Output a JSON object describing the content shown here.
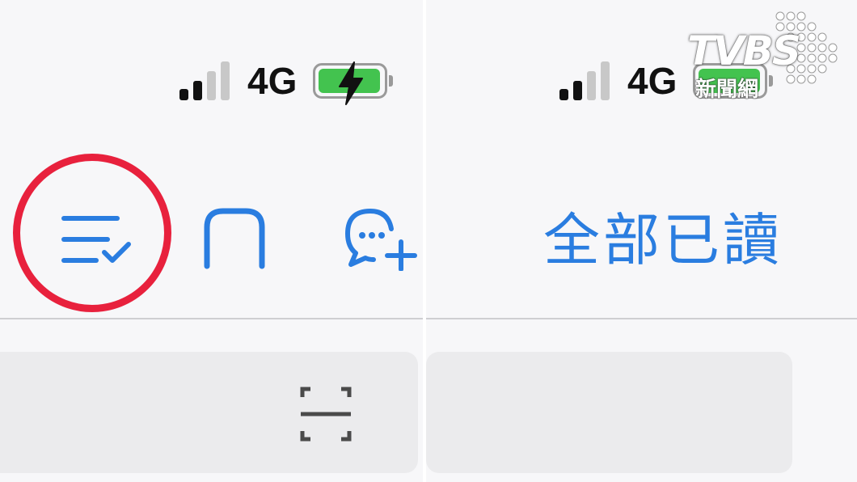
{
  "status_left": {
    "network": "4G",
    "battery_charging": true
  },
  "status_right": {
    "network": "4G"
  },
  "nav": {
    "mark_all_read": "全部已讀"
  },
  "watermark": {
    "brand": "TVBS",
    "sub": "新聞網"
  },
  "colors": {
    "accent": "#2a7de0",
    "highlight": "#e8213d",
    "battery": "#43c34f"
  },
  "icons": [
    "list-check-icon",
    "square-icon",
    "chat-plus-icon",
    "scan-icon",
    "signal-icon",
    "battery-icon",
    "lightning-icon"
  ]
}
